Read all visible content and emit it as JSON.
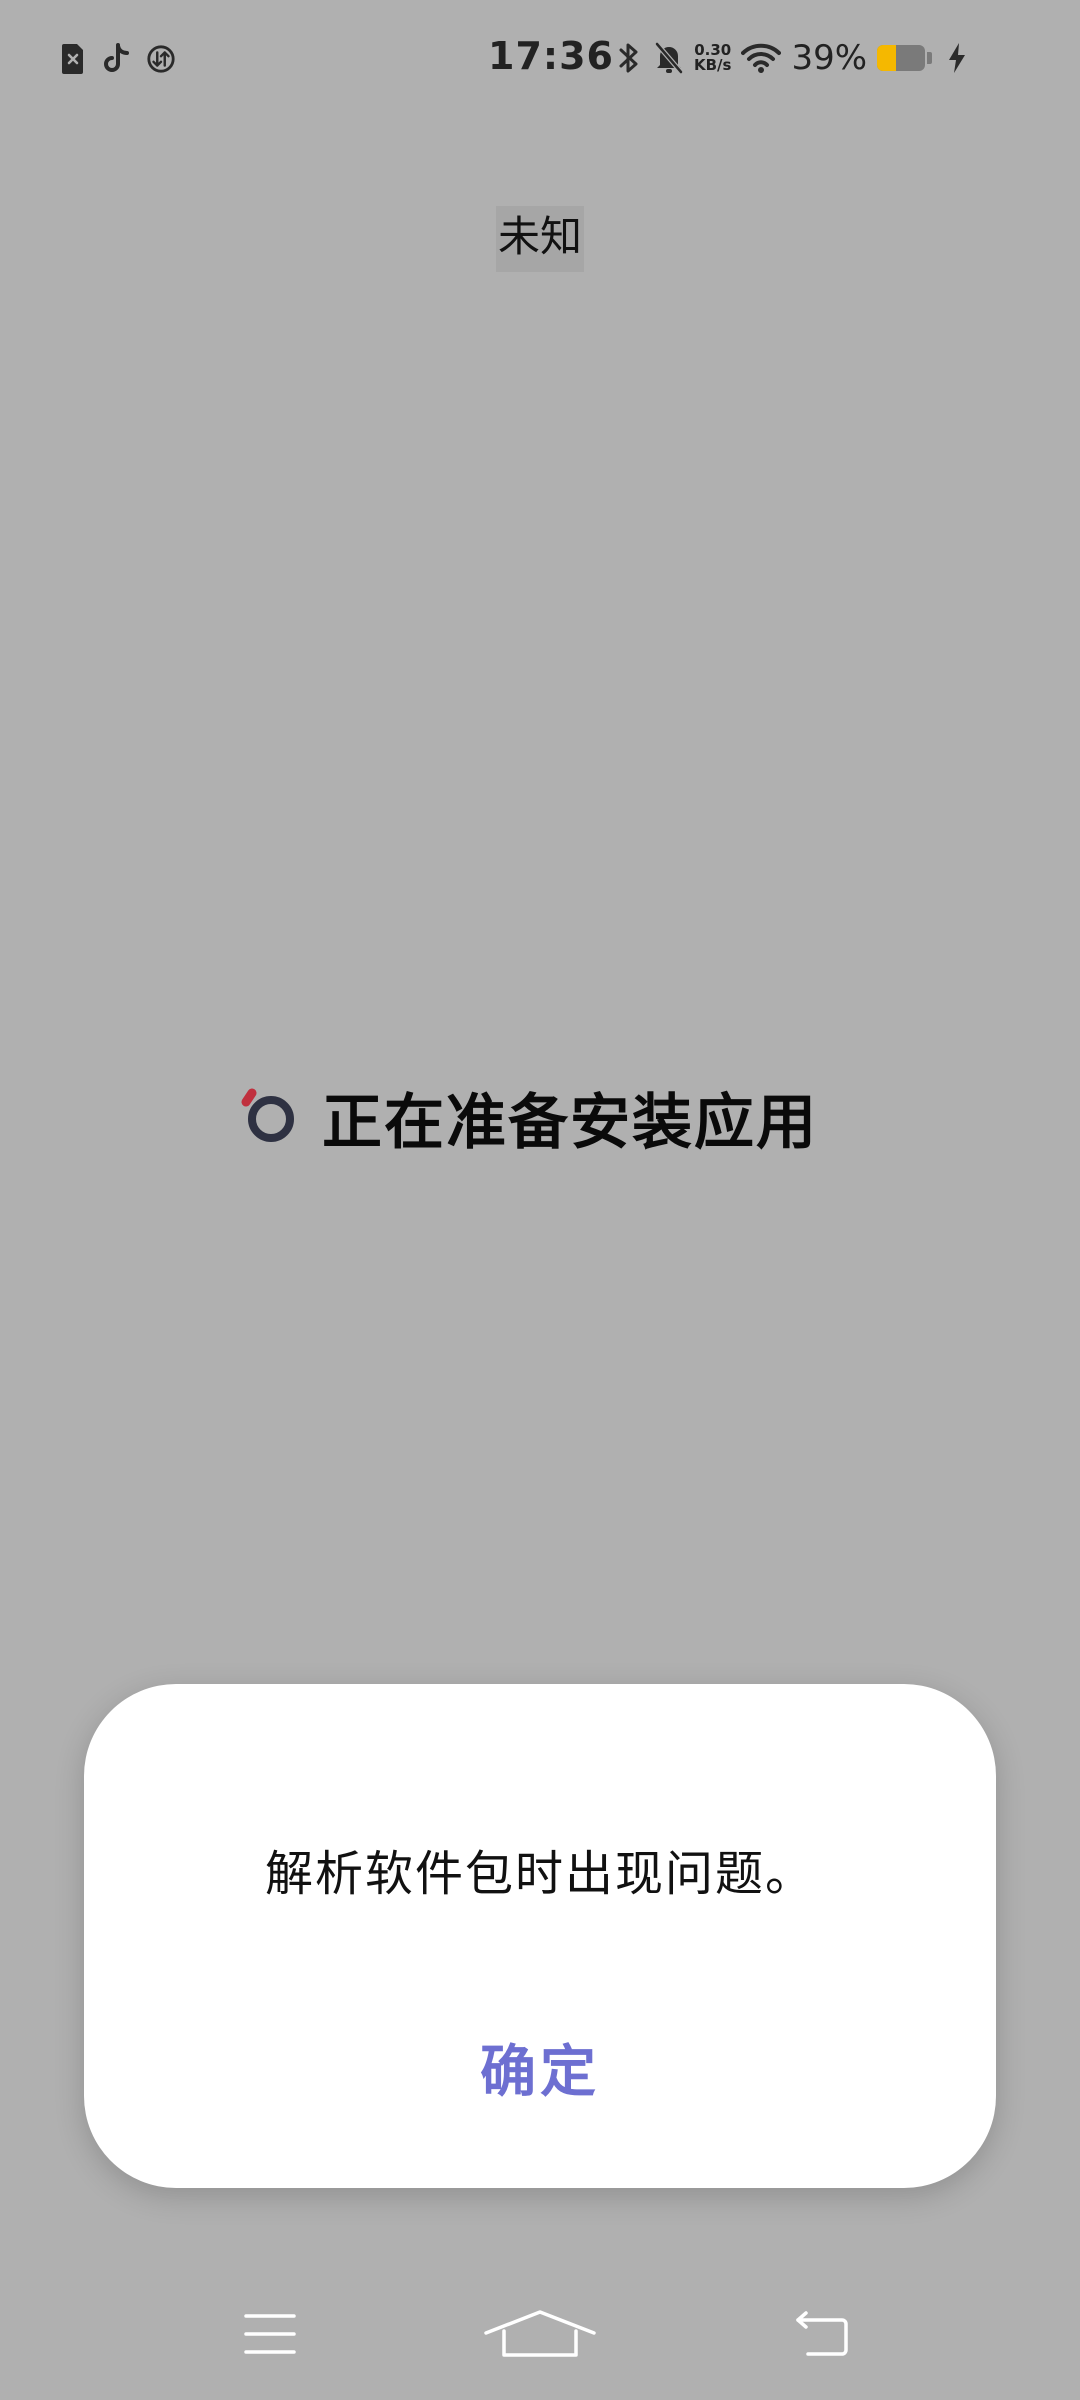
{
  "status_bar": {
    "time": "17:36",
    "net_speed_value": "0.30",
    "net_speed_unit": "KB/s",
    "battery_percent": "39%",
    "battery_level": 0.39,
    "left_icons": [
      "sim-error-icon",
      "tiktok-icon",
      "data-usage-icon"
    ],
    "right_icons": [
      "bluetooth-icon",
      "mute-bell-icon",
      "wifi-icon",
      "battery-icon",
      "charging-icon"
    ]
  },
  "app": {
    "title": "未知"
  },
  "installer": {
    "status": "正在准备安装应用",
    "spinner_icon": "loading-spinner-icon"
  },
  "dialog": {
    "message": "解析软件包时出现问题。",
    "confirm_label": "确定"
  },
  "nav": {
    "menu_icon": "menu-icon",
    "home_icon": "home-icon",
    "back_icon": "back-icon"
  },
  "colors": {
    "background": "#b0b0b0",
    "dialog_bg": "#ffffff",
    "accent": "#6d6fd1",
    "battery_fill": "#f5b800",
    "spinner_ring": "#2e3142",
    "spinner_dot": "#c0303e"
  }
}
